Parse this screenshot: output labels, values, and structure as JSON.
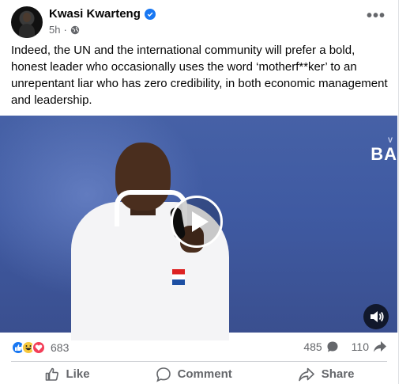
{
  "post": {
    "author": "Kwasi Kwarteng",
    "time": "5h",
    "separator": "·",
    "more_label": "•••",
    "text": "Indeed, the UN and the international community will prefer a bold, honest leader who occasionally uses the word ‘motherf**ker’ to an unrepentant liar who has zero credibility, in both economic management and leadership."
  },
  "video": {
    "banner_text": "BA",
    "banner_sub": "V"
  },
  "engagement": {
    "reactions": [
      "like-icon",
      "haha-icon",
      "love-icon"
    ],
    "reaction_count": "683",
    "comment_count": "485",
    "share_count": "110"
  },
  "actions": {
    "like": "Like",
    "comment": "Comment",
    "share": "Share"
  },
  "colors": {
    "accent": "#1877f2",
    "text": "#050505",
    "secondary": "#65676b"
  }
}
